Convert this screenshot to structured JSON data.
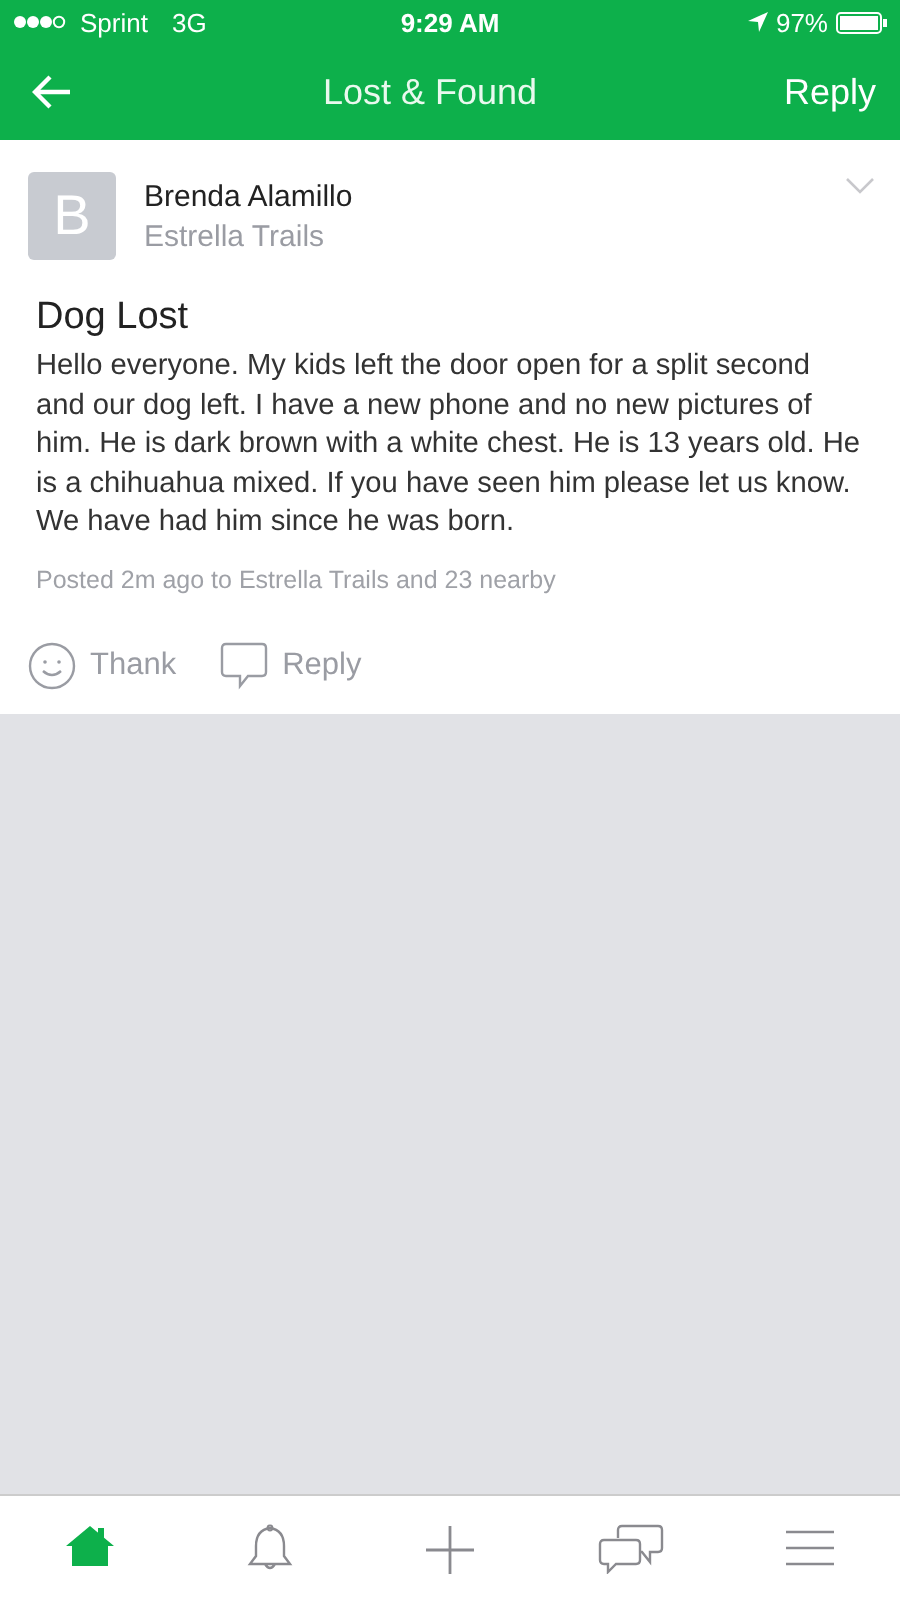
{
  "status_bar": {
    "carrier": "Sprint",
    "network": "3G",
    "time": "9:29 AM",
    "battery": "97%"
  },
  "nav": {
    "title": "Lost & Found",
    "action": "Reply"
  },
  "post": {
    "author": "Brenda Alamillo",
    "avatar_letter": "B",
    "neighborhood": "Estrella Trails",
    "title": "Dog Lost",
    "body": "Hello everyone. My kids left the door open for a split second and our dog left. I have a new phone and no new pictures of him. He is dark brown with a white chest. He is 13 years old. He is a chihuahua mixed. If you have seen him please let us know. We have had him since he was born.",
    "meta": "Posted 2m ago to Estrella Trails and 23 nearby",
    "actions": [
      {
        "kind": "thank",
        "label": "Thank"
      },
      {
        "kind": "reply",
        "label": "Reply"
      }
    ]
  },
  "tab_bar": [
    {
      "kind": "home",
      "selected": true
    },
    {
      "kind": "bell",
      "selected": false
    },
    {
      "kind": "plus",
      "selected": false
    },
    {
      "kind": "chat",
      "selected": false
    },
    {
      "kind": "menu",
      "selected": false
    }
  ]
}
